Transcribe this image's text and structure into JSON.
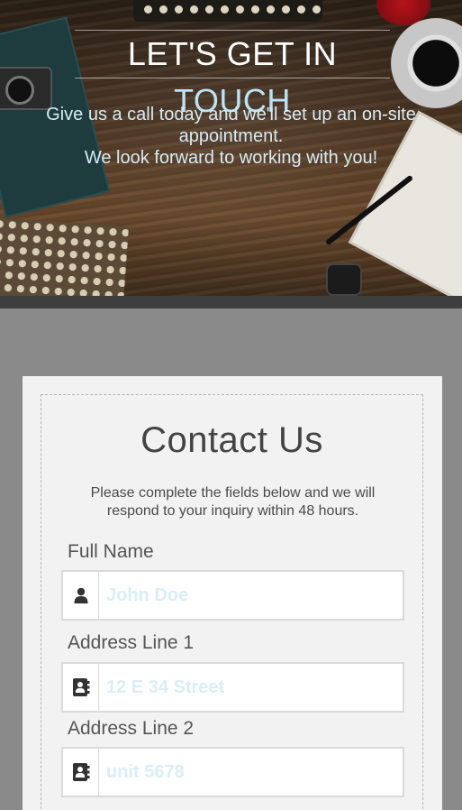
{
  "hero": {
    "title_main": "LET'S GET IN",
    "title_accent": "TOUCH",
    "line1": "Give us a call today and we'll set up an on-site",
    "line2": "appointment.",
    "line3": "We look forward to working with you!"
  },
  "contact": {
    "title": "Contact Us",
    "description_line1": "Please complete the fields below and we will",
    "description_line2": "respond to your inquiry within 48 hours.",
    "fields": [
      {
        "label": "Full Name",
        "placeholder": "John Doe",
        "icon": "user-icon"
      },
      {
        "label": "Address Line 1",
        "placeholder": "12 E 34 Street",
        "icon": "address-book-icon"
      },
      {
        "label": "Address Line 2",
        "placeholder": "unit 5678",
        "icon": "address-book-icon"
      }
    ]
  },
  "colors": {
    "accent": "#bde3f5",
    "placeholder": "#d9eef7",
    "card_background": "#f2f2f2",
    "page_background": "#8a8a8a"
  }
}
